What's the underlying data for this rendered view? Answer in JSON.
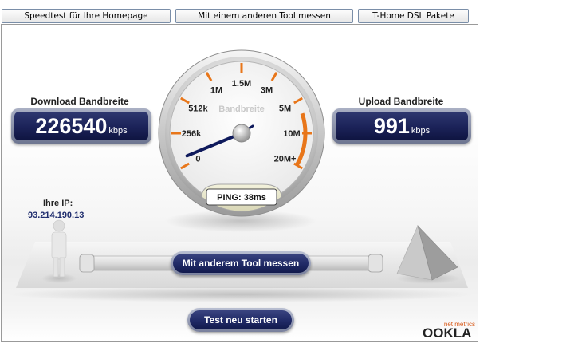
{
  "tabs": [
    {
      "label": "Speedtest für Ihre Homepage"
    },
    {
      "label": "Mit einem anderen Tool messen"
    },
    {
      "label": "T-Home DSL Pakete"
    }
  ],
  "download": {
    "label": "Download Bandbreite",
    "value": "226540",
    "unit": "kbps"
  },
  "upload": {
    "label": "Upload Bandbreite",
    "value": "991",
    "unit": "kbps"
  },
  "gauge": {
    "title": "Bandbreite",
    "ticks": [
      "0",
      "256k",
      "512k",
      "1M",
      "1.5M",
      "3M",
      "5M",
      "10M",
      "20M+"
    ],
    "ping_text": "PING: 38ms",
    "accent_color": "#e8761a"
  },
  "ip": {
    "label": "Ihre IP:",
    "value": "93.214.190.13"
  },
  "buttons": {
    "other_tool": "Mit anderem Tool messen",
    "restart": "Test neu starten"
  },
  "branding": {
    "company": "OOKLA",
    "tagline": "net metrics"
  }
}
